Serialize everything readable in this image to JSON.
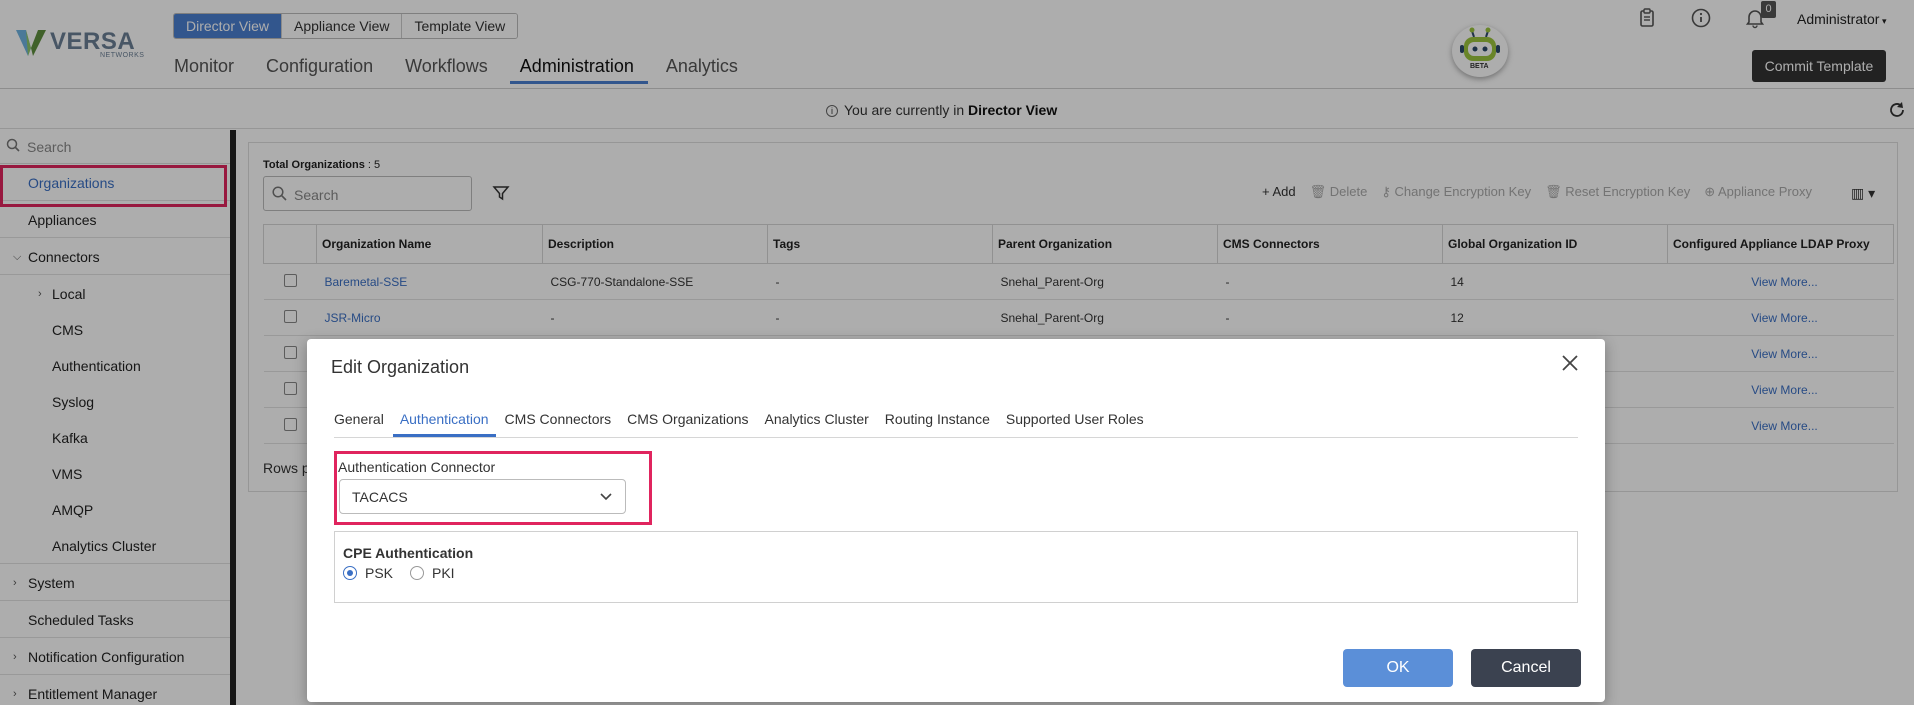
{
  "brand": {
    "name": "VERSA",
    "sub": "NETWORKS",
    "bot_badge": "BETA"
  },
  "view_tabs": [
    {
      "label": "Director View",
      "active": true
    },
    {
      "label": "Appliance View",
      "active": false
    },
    {
      "label": "Template View",
      "active": false
    }
  ],
  "main_nav": [
    {
      "label": "Monitor"
    },
    {
      "label": "Configuration"
    },
    {
      "label": "Workflows"
    },
    {
      "label": "Administration",
      "active": true
    },
    {
      "label": "Analytics"
    }
  ],
  "header": {
    "notification_count": "0",
    "user": "Administrator",
    "commit_label": "Commit Template",
    "icons": [
      "clipboard-icon",
      "info-icon",
      "bell-icon"
    ]
  },
  "infobar": {
    "prefix": "You are currently in",
    "view": "Director View"
  },
  "sidebar": {
    "search_placeholder": "Search",
    "items": [
      {
        "label": "Organizations",
        "active": true
      },
      {
        "label": "Appliances"
      },
      {
        "label": "Connectors",
        "expanded": true
      },
      {
        "label": "Local"
      },
      {
        "label": "CMS"
      },
      {
        "label": "Authentication"
      },
      {
        "label": "Syslog"
      },
      {
        "label": "Kafka"
      },
      {
        "label": "VMS"
      },
      {
        "label": "AMQP"
      },
      {
        "label": "Analytics Cluster"
      },
      {
        "label": "System"
      },
      {
        "label": "Scheduled Tasks"
      },
      {
        "label": "Notification Configuration"
      },
      {
        "label": "Entitlement Manager"
      }
    ]
  },
  "orgs": {
    "total_label": "Total Organizations",
    "total_value": ": 5",
    "search_placeholder": "Search",
    "actions": [
      "Add",
      "Delete",
      "Change Encryption Key",
      "Reset Encryption Key",
      "Appliance Proxy"
    ],
    "columns": [
      "Organization Name",
      "Description",
      "Tags",
      "Parent Organization",
      "CMS Connectors",
      "Global Organization ID",
      "Configured Appliance LDAP Proxy"
    ],
    "rows": [
      {
        "name": "Baremetal-SSE",
        "description": "CSG-770-Standalone-SSE",
        "tags": "-",
        "parent": "Snehal_Parent-Org",
        "cms": "-",
        "gid": "14",
        "ldap": "View More..."
      },
      {
        "name": "JSR-Micro",
        "description": "-",
        "tags": "-",
        "parent": "Snehal_Parent-Org",
        "cms": "-",
        "gid": "12",
        "ldap": "View More..."
      },
      {
        "name": "",
        "description": "",
        "tags": "",
        "parent": "",
        "cms": "",
        "gid": "",
        "ldap": "View More..."
      },
      {
        "name": "",
        "description": "",
        "tags": "",
        "parent": "",
        "cms": "",
        "gid": "",
        "ldap": "View More..."
      },
      {
        "name": "",
        "description": "",
        "tags": "",
        "parent": "",
        "cms": "",
        "gid": "",
        "ldap": "View More..."
      }
    ],
    "rows_per_page_label": "Rows p"
  },
  "modal": {
    "title": "Edit Organization",
    "tabs": [
      {
        "label": "General"
      },
      {
        "label": "Authentication",
        "active": true
      },
      {
        "label": "CMS Connectors"
      },
      {
        "label": "CMS Organizations"
      },
      {
        "label": "Analytics Cluster"
      },
      {
        "label": "Routing Instance"
      },
      {
        "label": "Supported User Roles"
      }
    ],
    "auth_connector_label": "Authentication Connector",
    "auth_connector_value": "TACACS",
    "cpe_title": "CPE Authentication",
    "cpe_options": [
      {
        "label": "PSK",
        "selected": true
      },
      {
        "label": "PKI",
        "selected": false
      }
    ],
    "ok_label": "OK",
    "cancel_label": "Cancel"
  },
  "colors": {
    "accent": "#3a6fc4",
    "highlight": "#e0245e",
    "commit_bg": "#333333",
    "cancel_bg": "#3b4250",
    "ok_bg": "#5b8fd8"
  }
}
